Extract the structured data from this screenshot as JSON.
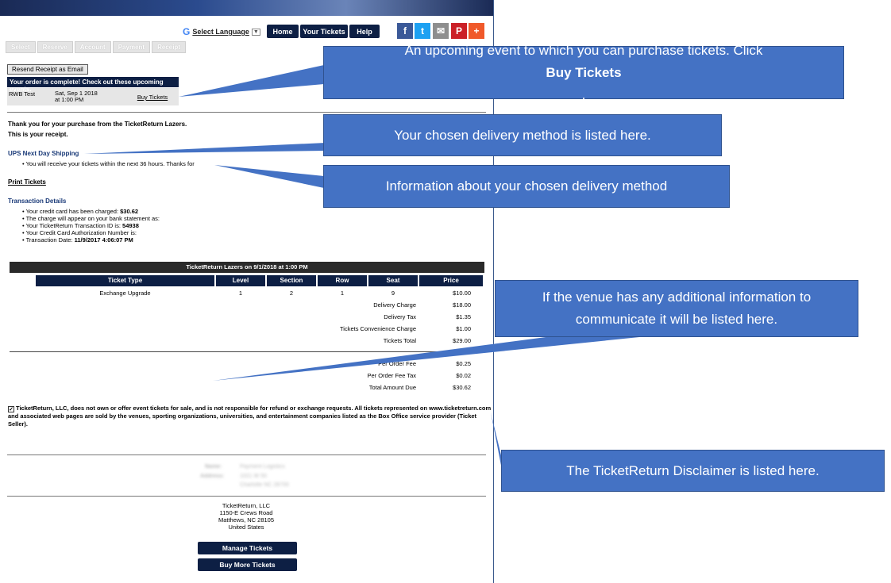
{
  "header": {
    "language_label": "Select Language",
    "google_glyph": "G",
    "nav": [
      "Home",
      "Your Tickets",
      "Help"
    ],
    "social_icons": [
      {
        "name": "facebook-icon",
        "glyph": "f",
        "color": "#3b5998"
      },
      {
        "name": "twitter-icon",
        "glyph": "t",
        "color": "#1da1f2"
      },
      {
        "name": "email-icon",
        "glyph": "✉",
        "color": "#8e8e8e"
      },
      {
        "name": "pinterest-icon",
        "glyph": "P",
        "color": "#cb2027"
      },
      {
        "name": "share-plus-icon",
        "glyph": "+",
        "color": "#f0592a"
      }
    ]
  },
  "steps": [
    "Select",
    "Reserve",
    "Account",
    "Payment",
    "Receipt"
  ],
  "resend_label": "Resend Receipt as Email",
  "upcoming": {
    "heading": "Your order is complete! Check out these upcoming events.",
    "event_name": "RWB Test",
    "event_date_line1": "Sat, Sep 1 2018",
    "event_date_line2": "at 1:00 PM",
    "buy_label": "Buy Tickets"
  },
  "receipt": {
    "thanks": "Thank you for your purchase from the TicketReturn Lazers.",
    "is_receipt": "This is your receipt.",
    "delivery_method": "UPS Next Day Shipping",
    "delivery_info": "You will receive your tickets within the next 36 hours. Thanks for",
    "print_tickets": "Print Tickets",
    "transaction_heading": "Transaction Details",
    "details": [
      {
        "text": "Your credit card has been charged: ",
        "strong": "$30.62"
      },
      {
        "text": "The charge will appear on your bank statement as:",
        "strong": ""
      },
      {
        "text": "Your TicketReturn Transaction ID is: ",
        "strong": "54938"
      },
      {
        "text": "Your Credit Card Authorization Number is:",
        "strong": ""
      },
      {
        "text": "Transaction Date: ",
        "strong": "11/9/2017 4:06:07 PM"
      }
    ]
  },
  "table": {
    "title": "TicketReturn Lazers on 9/1/2018 at 1:00 PM",
    "columns": [
      "Ticket Type",
      "Level",
      "Section",
      "Row",
      "Seat",
      "Price"
    ],
    "row": [
      "Exchange Upgrade",
      "1",
      "2",
      "1",
      "9",
      "$10.00"
    ],
    "fees": [
      {
        "label": "Delivery Charge",
        "value": "$18.00"
      },
      {
        "label": "Delivery Tax",
        "value": "$1.35"
      },
      {
        "label": "Tickets Convenience Charge",
        "value": "$1.00"
      },
      {
        "label": "Tickets Total",
        "value": "$29.00"
      }
    ],
    "order_fees": [
      {
        "label": "Per Order Fee",
        "value": "$0.25"
      },
      {
        "label": "Per Order Fee Tax",
        "value": "$0.02"
      },
      {
        "label": "Total Amount Due",
        "value": "$30.62"
      }
    ]
  },
  "disclaimer": "TicketReturn, LLC, does not own or offer event tickets for sale, and is not responsible for refund or exchange requests. All tickets represented on www.ticketreturn.com and associated web pages are sold by the venues, sporting organizations, universities, and entertainment companies listed as the Box Office service provider (Ticket Seller).",
  "blurred": {
    "name_label": "Name:",
    "name_value": "Payment Logistics",
    "address_label": "Address:",
    "address_line1": "1021 W 50",
    "address_line2": "Charlotte NC 28700"
  },
  "company": {
    "name": "TicketReturn, LLC",
    "street": "1150-E Crews Road",
    "city": "Matthews, NC 28105",
    "country": "United States"
  },
  "buttons": {
    "manage": "Manage Tickets",
    "buy_more": "Buy More Tickets"
  },
  "callouts": {
    "upcoming_pre": "An upcoming event to which you can purchase tickets. Click ",
    "upcoming_bold": "Buy Tickets",
    "upcoming_post": ".",
    "delivery": "Your chosen delivery method is listed here.",
    "delivery_info": "Information about your chosen delivery method",
    "venue_line1": "If the venue has any additional information to",
    "venue_line2": "communicate it will be listed here.",
    "disclaimer": "The TicketReturn Disclaimer is listed here."
  }
}
